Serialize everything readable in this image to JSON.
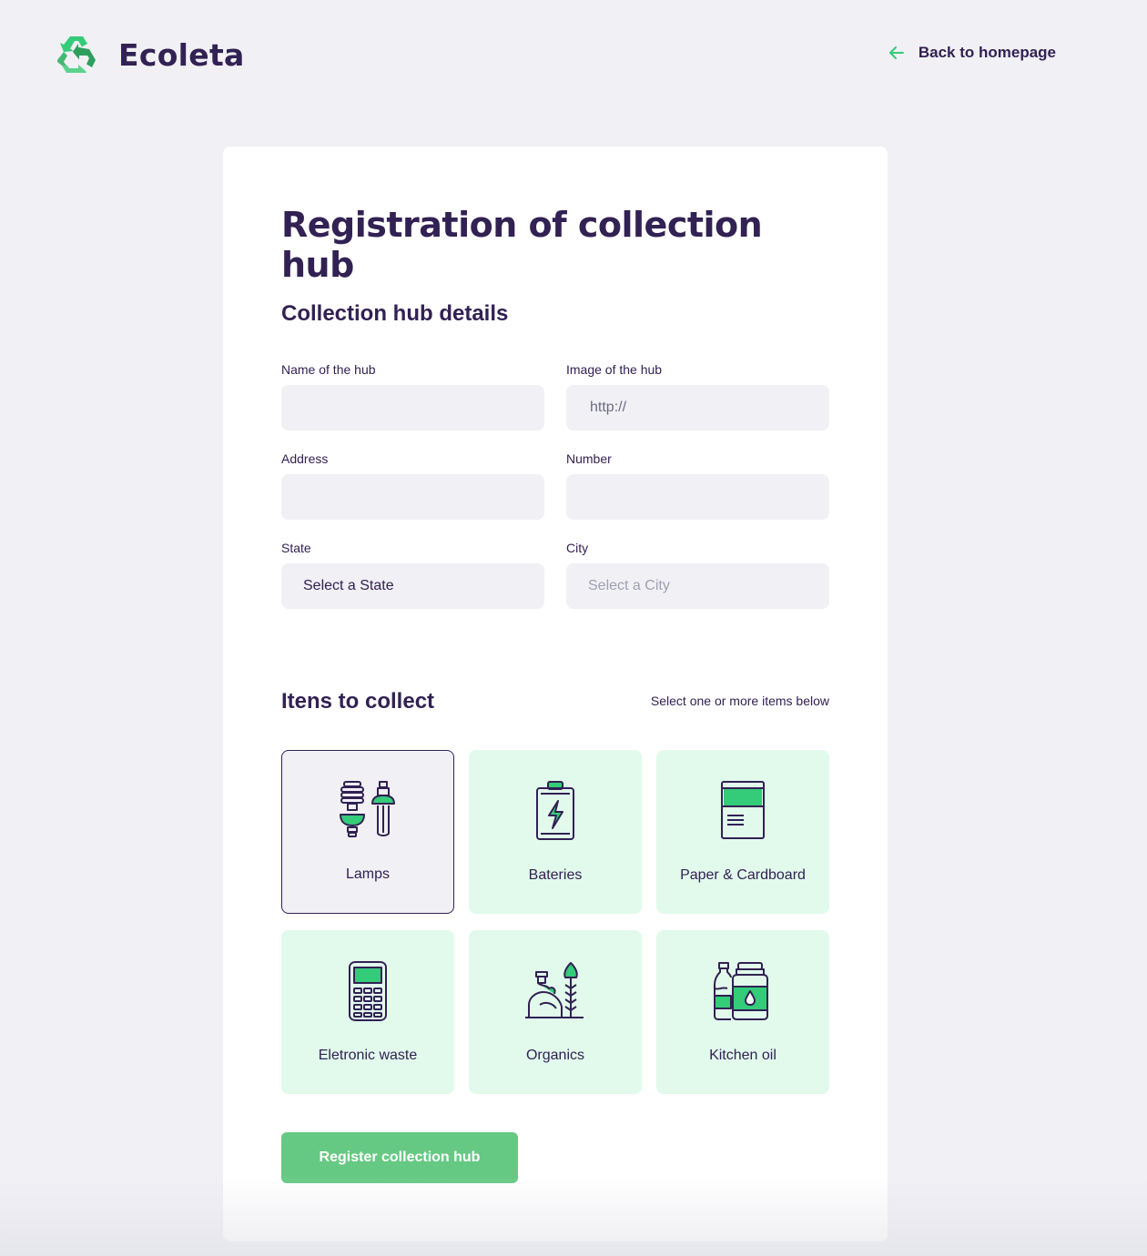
{
  "app": {
    "name": "Ecoleta"
  },
  "header": {
    "back_label": "Back to homepage"
  },
  "page": {
    "title": "Registration of collection hub"
  },
  "details": {
    "title": "Collection hub details",
    "name_label": "Name of the hub",
    "name_value": "",
    "image_label": "Image of the hub",
    "image_placeholder": "http://",
    "address_label": "Address",
    "address_value": "",
    "number_label": "Number",
    "number_value": "",
    "state_label": "State",
    "state_selected": "Select a State",
    "city_label": "City",
    "city_selected": "Select a City"
  },
  "items": {
    "title": "Itens to collect",
    "hint": "Select one or more items below",
    "list": [
      {
        "label": "Lamps",
        "icon": "lamps-icon",
        "selected": true
      },
      {
        "label": "Bateries",
        "icon": "battery-icon",
        "selected": false
      },
      {
        "label": "Paper & Cardboard",
        "icon": "paper-icon",
        "selected": false
      },
      {
        "label": "Eletronic waste",
        "icon": "electronic-icon",
        "selected": false
      },
      {
        "label": "Organics",
        "icon": "organics-icon",
        "selected": false
      },
      {
        "label": "Kitchen oil",
        "icon": "oil-icon",
        "selected": false
      }
    ]
  },
  "submit": {
    "label": "Register collection hub"
  },
  "colors": {
    "primary": "#322153",
    "accent": "#34CB79",
    "item_bg": "#E1FAEC",
    "button": "#66C983",
    "page_bg": "#F0F0F5"
  }
}
